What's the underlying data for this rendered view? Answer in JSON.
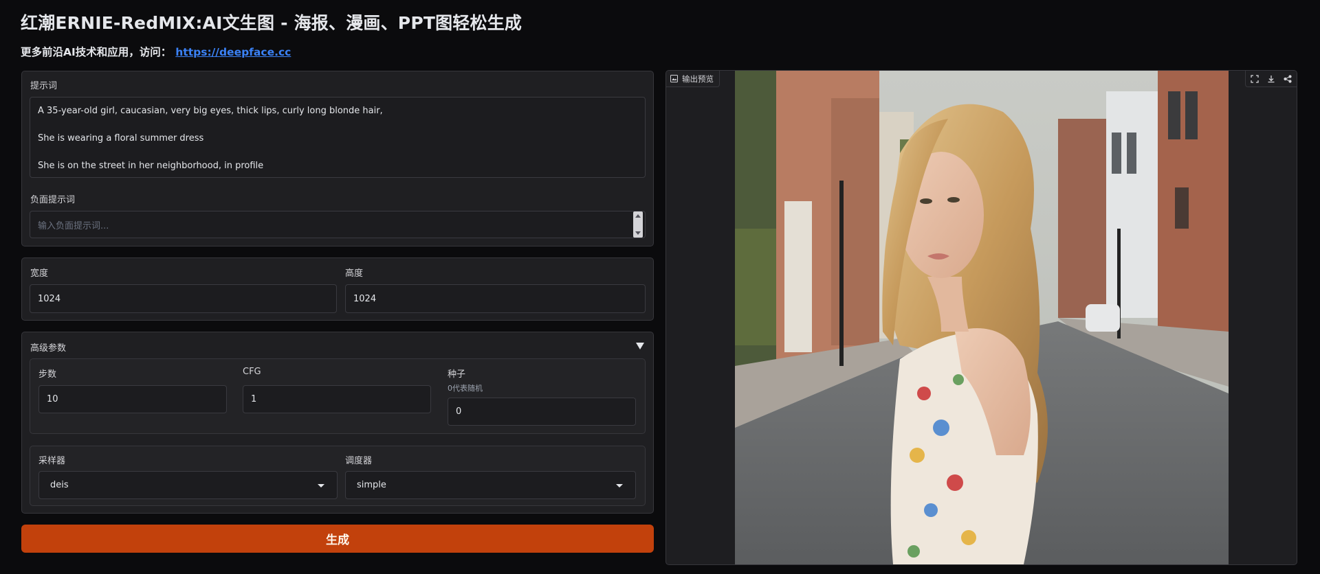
{
  "header": {
    "title": "红潮ERNIE-RedMIX:AI文生图 - 海报、漫画、PPT图轻松生成",
    "subtitle_prefix": "更多前沿AI技术和应用，访问：",
    "subtitle_link": "https://deepface.cc"
  },
  "prompt": {
    "label": "提示词",
    "lines": [
      "A 35-year-old girl, caucasian, very big eyes, thick lips, curly long blonde hair,",
      "She is wearing a floral summer dress",
      "She is on the street in her neighborhood, in profile"
    ]
  },
  "negative_prompt": {
    "label": "负面提示词",
    "value": "",
    "placeholder": "输入负面提示词..."
  },
  "size": {
    "width_label": "宽度",
    "width_value": "1024",
    "height_label": "高度",
    "height_value": "1024"
  },
  "advanced": {
    "title": "高级参数",
    "steps_label": "步数",
    "steps_value": "10",
    "cfg_label": "CFG",
    "cfg_value": "1",
    "seed_label": "种子",
    "seed_hint": "0代表随机",
    "seed_value": "0",
    "sampler_label": "采样器",
    "sampler_value": "deis",
    "scheduler_label": "调度器",
    "scheduler_value": "simple"
  },
  "generate_button": "生成",
  "output": {
    "tag": "输出预览",
    "icons": [
      "image-icon",
      "fullscreen-icon",
      "download-icon",
      "share-icon"
    ]
  },
  "colors": {
    "background": "#0b0b0d",
    "panel": "#1f1f22",
    "accent_button": "#c2410c",
    "link": "#3b82f6"
  }
}
